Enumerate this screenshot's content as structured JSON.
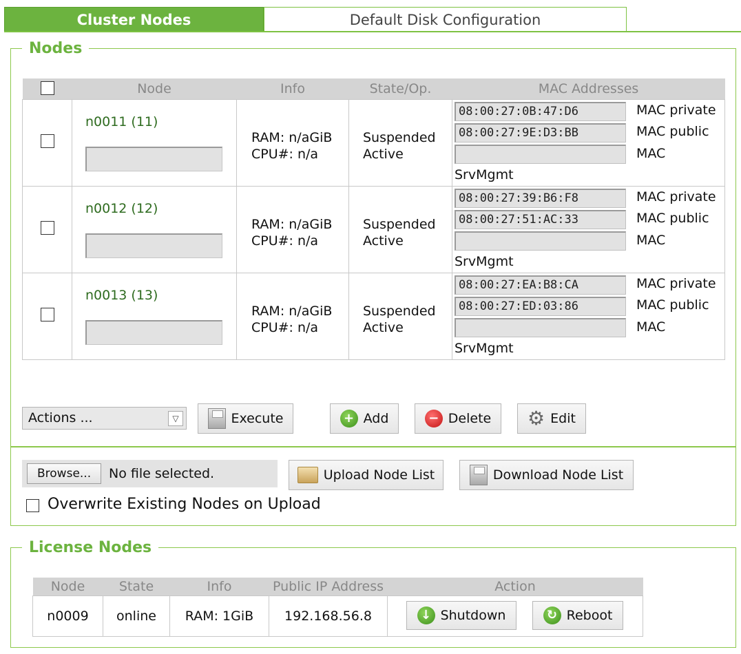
{
  "tabs": [
    {
      "label": "Cluster Nodes",
      "active": true
    },
    {
      "label": "Default Disk Configuration",
      "active": false
    }
  ],
  "nodes_section": {
    "legend": "Nodes",
    "columns": {
      "node": "Node",
      "info": "Info",
      "state": "State/Op.",
      "mac": "MAC Addresses"
    },
    "rows": [
      {
        "name": "n0011 (11)",
        "ram": "RAM: n/aGiB",
        "cpu": "CPU#: n/a",
        "state": "Suspended",
        "op": "Active",
        "mac_private": "08:00:27:0B:47:D6",
        "mac_public": "08:00:27:9E:D3:BB",
        "mac_srvmgmt": ""
      },
      {
        "name": "n0012 (12)",
        "ram": "RAM: n/aGiB",
        "cpu": "CPU#: n/a",
        "state": "Suspended",
        "op": "Active",
        "mac_private": "08:00:27:39:B6:F8",
        "mac_public": "08:00:27:51:AC:33",
        "mac_srvmgmt": ""
      },
      {
        "name": "n0013 (13)",
        "ram": "RAM: n/aGiB",
        "cpu": "CPU#: n/a",
        "state": "Suspended",
        "op": "Active",
        "mac_private": "08:00:27:EA:B8:CA",
        "mac_public": "08:00:27:ED:03:86",
        "mac_srvmgmt": ""
      }
    ],
    "mac_labels": {
      "private": "MAC private",
      "public": "MAC public",
      "srv_line1": "MAC",
      "srv_line2": "SrvMgmt"
    },
    "actions_select": "Actions ...",
    "buttons": {
      "execute": "Execute",
      "add": "Add",
      "delete": "Delete",
      "edit": "Edit"
    }
  },
  "upload": {
    "browse": "Browse...",
    "no_file": "No file selected.",
    "upload_button": "Upload Node List",
    "download_button": "Download Node List",
    "overwrite_label": "Overwrite Existing Nodes on Upload"
  },
  "license_section": {
    "legend": "License Nodes",
    "columns": {
      "node": "Node",
      "state": "State",
      "info": "Info",
      "ip": "Public IP Address",
      "action": "Action"
    },
    "rows": [
      {
        "node": "n0009",
        "state": "online",
        "info": "RAM: 1GiB",
        "ip": "192.168.56.8"
      }
    ],
    "buttons": {
      "shutdown": "Shutdown",
      "reboot": "Reboot"
    }
  }
}
